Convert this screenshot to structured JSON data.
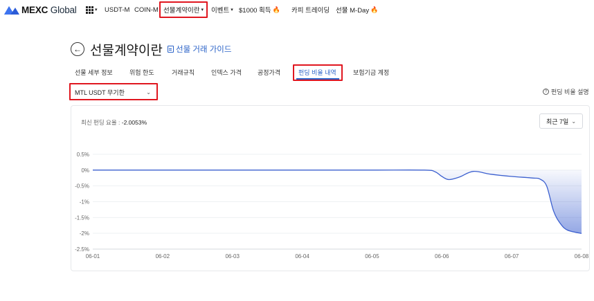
{
  "nav": {
    "logo_main": "MEXC",
    "logo_sub": "Global",
    "items": [
      {
        "label": "USDT-M"
      },
      {
        "label": "COIN-M"
      },
      {
        "label": "선물계약이란"
      },
      {
        "label": "이벤트"
      },
      {
        "label": "$1000 획득"
      },
      {
        "label": "카피 트레이딩"
      },
      {
        "label": "선물 M-Day"
      }
    ]
  },
  "header": {
    "title": "선물계약이란",
    "guide": "선물 거래 가이드"
  },
  "tabs": [
    {
      "label": "선물 세부 정보"
    },
    {
      "label": "위험 한도"
    },
    {
      "label": "거래규칙"
    },
    {
      "label": "인덱스 가격"
    },
    {
      "label": "공정가격"
    },
    {
      "label": "펀딩 비율 내역"
    },
    {
      "label": "보험기금 계정"
    }
  ],
  "selector": {
    "value": "MTL USDT 무기한"
  },
  "explain": "펀딩 비율 설명",
  "card": {
    "latest_label": "최신 펀딩 요율 :",
    "latest_value": "-2.0053%",
    "period": "최근 7일"
  },
  "colors": {
    "accent": "#2b63c8",
    "highlight": "#e0161f",
    "line": "#3b5fcf"
  },
  "chart_data": {
    "type": "area",
    "x_ticks": [
      "06-01",
      "06-02",
      "06-03",
      "06-04",
      "06-05",
      "06-06",
      "06-07",
      "06-08"
    ],
    "y_ticks": [
      "0.5%",
      "0%",
      "-0.5%",
      "-1%",
      "-1.5%",
      "-2%",
      "-2.5%"
    ],
    "y_tick_values": [
      0.5,
      0,
      -0.5,
      -1,
      -1.5,
      -2,
      -2.5
    ],
    "ylim": [
      -2.5,
      0.5
    ],
    "grid": true,
    "x": [
      0,
      1,
      2,
      3,
      4,
      4.75,
      4.9,
      5.0,
      5.1,
      5.25,
      5.45,
      5.7,
      6.0,
      6.3,
      6.4,
      6.5,
      6.6,
      6.7,
      6.8,
      7.0
    ],
    "values": [
      0,
      0,
      0,
      0,
      0,
      0,
      -0.05,
      -0.2,
      -0.3,
      -0.22,
      -0.04,
      -0.13,
      -0.2,
      -0.25,
      -0.28,
      -0.5,
      -1.3,
      -1.7,
      -1.9,
      -2.0053
    ]
  }
}
